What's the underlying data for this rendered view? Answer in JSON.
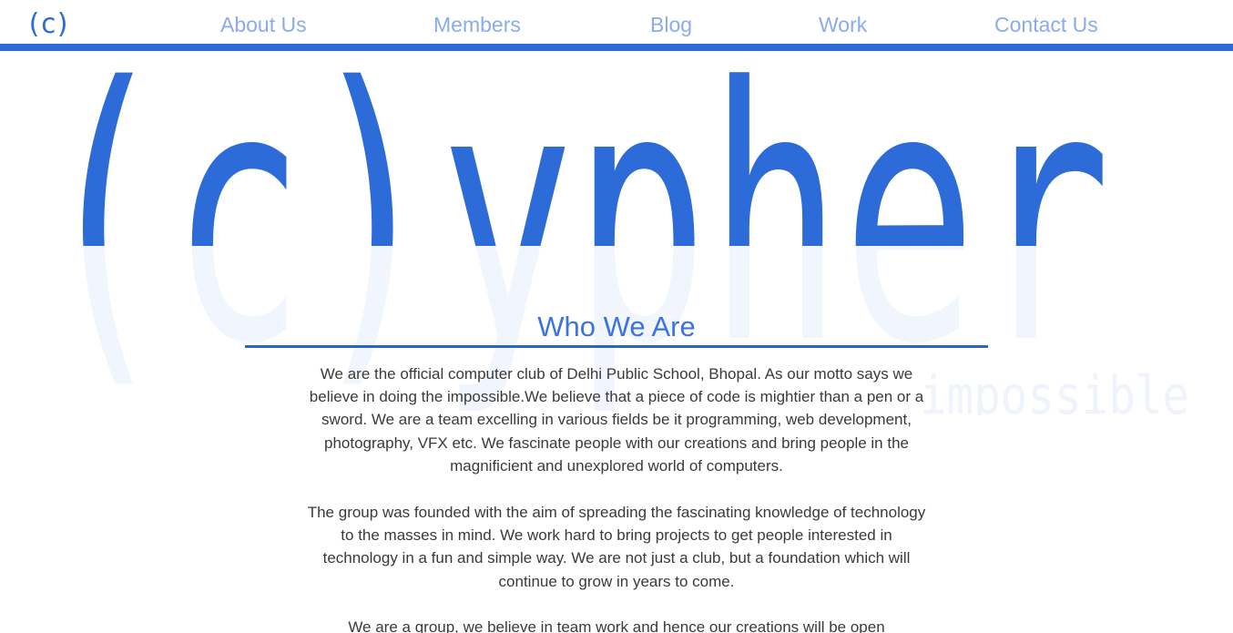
{
  "nav": {
    "logo": "(c)",
    "links": [
      "About Us",
      "Members",
      "Blog",
      "Work",
      "Contact Us"
    ]
  },
  "hero": {
    "wordmark": "(c)ypher",
    "watermark_word": "impossible"
  },
  "section": {
    "title": "Who We Are",
    "paragraphs": [
      "We are the official computer club of Delhi Public School, Bhopal. As our motto says we believe in doing the impossible.We believe that a piece of code is mightier than a pen or a sword. We are a team excelling in various fields be it programming, web development, photography, VFX etc. We fascinate people with our creations and bring people in the magnificient and unexplored world of computers.",
      "The group was founded with the aim of spreading the fascinating knowledge of technology to the masses in mind. We work hard to bring projects to get people interested in technology in a fun and simple way. We are not just a club, but a foundation which will continue to grow in years to come.",
      "We are a group, we believe in team work and hence our creations will be open"
    ]
  },
  "colors": {
    "brand": "#2d6bd8",
    "nav_text": "#8aabed",
    "watermark": "#f1f5fd"
  }
}
